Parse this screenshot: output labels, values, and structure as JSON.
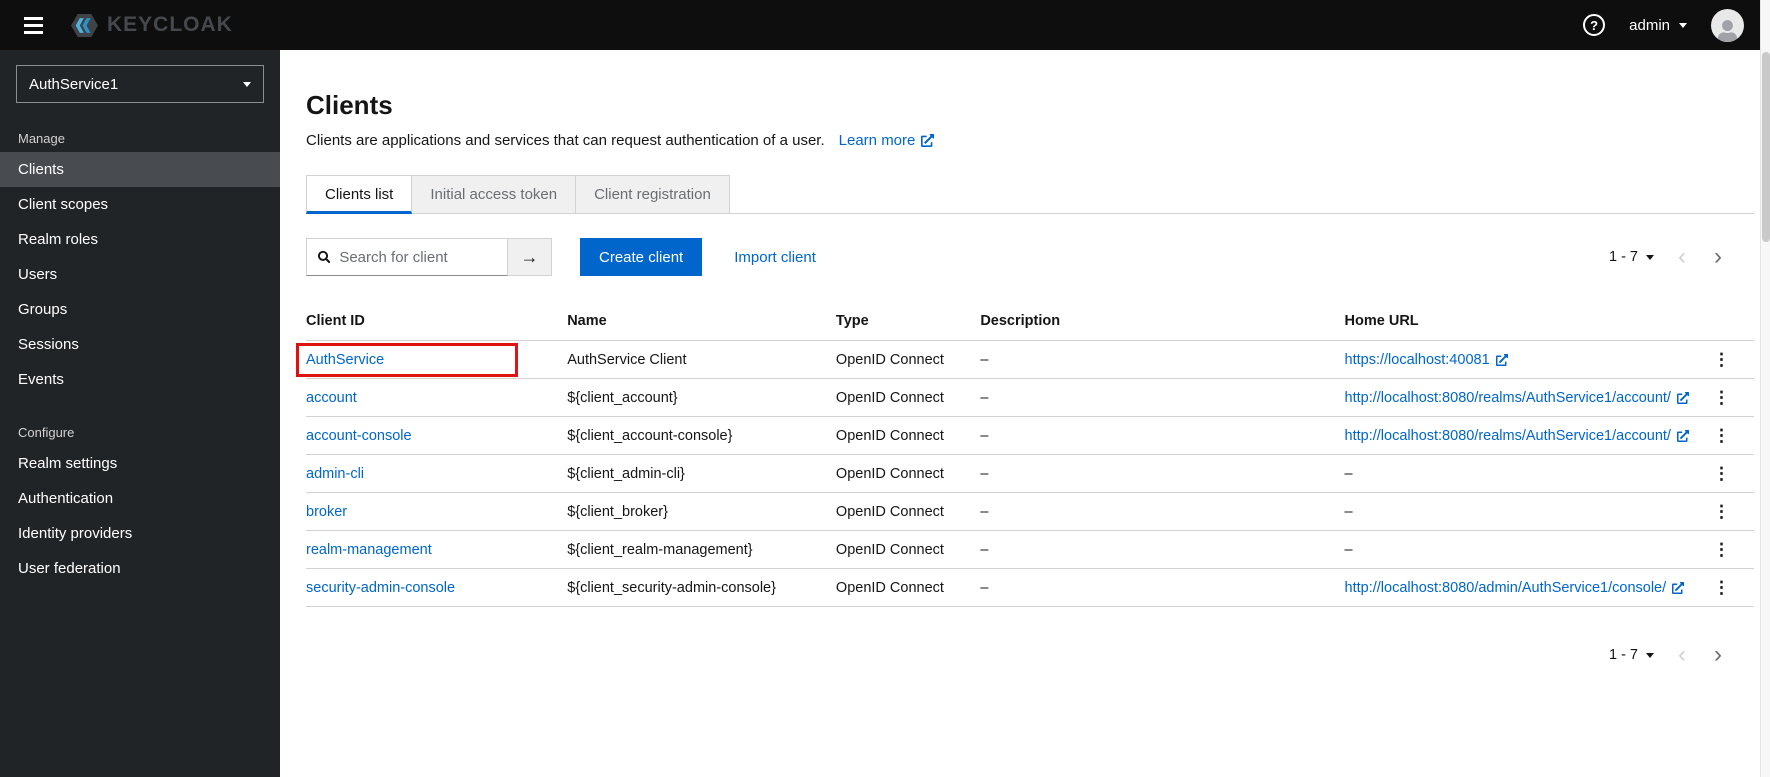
{
  "colors": {
    "accent": "#0066cc",
    "topbar_bg": "#0e0e0e",
    "sidebar_bg": "#212427",
    "highlight_red": "#e01313"
  },
  "icons": {
    "help": "?",
    "arrow_right": "→",
    "kebab": "⋮",
    "chevron_left": "‹",
    "chevron_right": "›"
  },
  "topbar": {
    "brand": "KEYCLOAK",
    "username": "admin"
  },
  "sidebar": {
    "realm": "AuthService1",
    "sections": [
      {
        "label": "Manage",
        "items": [
          "Clients",
          "Client scopes",
          "Realm roles",
          "Users",
          "Groups",
          "Sessions",
          "Events"
        ]
      },
      {
        "label": "Configure",
        "items": [
          "Realm settings",
          "Authentication",
          "Identity providers",
          "User federation"
        ]
      }
    ]
  },
  "main": {
    "title": "Clients",
    "subtitle": "Clients are applications and services that can request authentication of a user.",
    "learn_more": "Learn more",
    "tabs": [
      "Clients list",
      "Initial access token",
      "Client registration"
    ],
    "toolbar": {
      "search_placeholder": "Search for client",
      "create_button": "Create client",
      "import_label": "Import client"
    },
    "pagination": {
      "range": "1 - 7"
    },
    "table": {
      "columns": [
        "Client ID",
        "Name",
        "Type",
        "Description",
        "Home URL"
      ],
      "rows": [
        {
          "client_id": "AuthService",
          "name": "AuthService Client",
          "type": "OpenID Connect",
          "description": "–",
          "home_url": "https://localhost:40081"
        },
        {
          "client_id": "account",
          "name": "${client_account}",
          "type": "OpenID Connect",
          "description": "–",
          "home_url": "http://localhost:8080/realms/AuthService1/account/"
        },
        {
          "client_id": "account-console",
          "name": "${client_account-console}",
          "type": "OpenID Connect",
          "description": "–",
          "home_url": "http://localhost:8080/realms/AuthService1/account/"
        },
        {
          "client_id": "admin-cli",
          "name": "${client_admin-cli}",
          "type": "OpenID Connect",
          "description": "–",
          "home_url": "–"
        },
        {
          "client_id": "broker",
          "name": "${client_broker}",
          "type": "OpenID Connect",
          "description": "–",
          "home_url": "–"
        },
        {
          "client_id": "realm-management",
          "name": "${client_realm-management}",
          "type": "OpenID Connect",
          "description": "–",
          "home_url": "–"
        },
        {
          "client_id": "security-admin-console",
          "name": "${client_security-admin-console}",
          "type": "OpenID Connect",
          "description": "–",
          "home_url": "http://localhost:8080/admin/AuthService1/console/"
        }
      ]
    }
  }
}
